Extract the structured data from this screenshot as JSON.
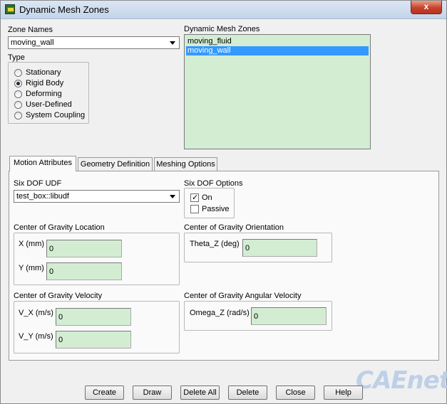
{
  "window": {
    "title": "Dynamic Mesh Zones",
    "close_glyph": "x"
  },
  "zone_names": {
    "label": "Zone Names",
    "selected": "moving_wall"
  },
  "type": {
    "label": "Type",
    "options": [
      {
        "label": "Stationary",
        "selected": false
      },
      {
        "label": "Rigid Body",
        "selected": true
      },
      {
        "label": "Deforming",
        "selected": false
      },
      {
        "label": "User-Defined",
        "selected": false
      },
      {
        "label": "System Coupling",
        "selected": false
      }
    ]
  },
  "dynamic_mesh_zones": {
    "label": "Dynamic Mesh Zones",
    "items": [
      {
        "label": "moving_fluid",
        "selected": false
      },
      {
        "label": "moving_wall",
        "selected": true
      }
    ]
  },
  "tabs": [
    {
      "label": "Motion Attributes",
      "active": true
    },
    {
      "label": "Geometry Definition",
      "active": false
    },
    {
      "label": "Meshing Options",
      "active": false
    }
  ],
  "six_dof_udf": {
    "label": "Six DOF UDF",
    "selected": "test_box::libudf"
  },
  "six_dof_options": {
    "label": "Six DOF Options",
    "on_label": "On",
    "on_checked": true,
    "passive_label": "Passive",
    "passive_checked": false
  },
  "cog_location": {
    "label": "Center of Gravity Location",
    "x_label": "X (mm)",
    "x_value": "0",
    "y_label": "Y (mm)",
    "y_value": "0"
  },
  "cog_orientation": {
    "label": "Center of Gravity Orientation",
    "theta_label": "Theta_Z (deg)",
    "theta_value": "0"
  },
  "cog_velocity": {
    "label": "Center of Gravity Velocity",
    "vx_label": "V_X (m/s)",
    "vx_value": "0",
    "vy_label": "V_Y (m/s)",
    "vy_value": "0"
  },
  "cog_angular_velocity": {
    "label": "Center of Gravity Angular Velocity",
    "omega_label": "Omega_Z (rad/s)",
    "omega_value": "0"
  },
  "buttons": {
    "create": "Create",
    "draw": "Draw",
    "delete_all": "Delete All",
    "delete": "Delete",
    "close": "Close",
    "help": "Help"
  },
  "watermark": "CAEnet"
}
